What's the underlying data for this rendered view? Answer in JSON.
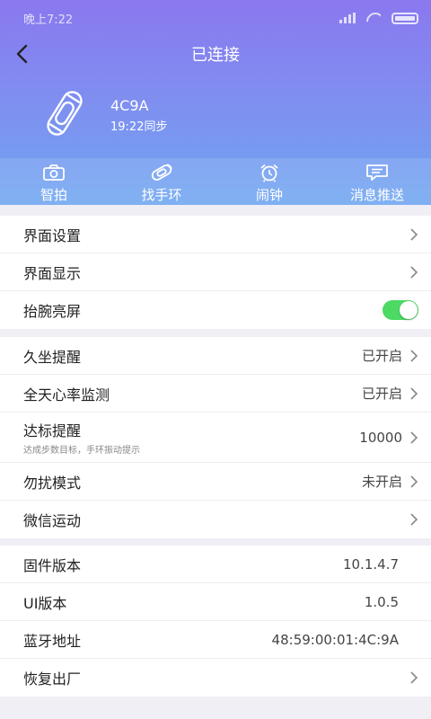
{
  "status_bar": {
    "time": "晚上7:22"
  },
  "header": {
    "title": "已连接"
  },
  "device": {
    "name": "4C9A",
    "sync_time": "19:22同步"
  },
  "toolbar": [
    {
      "label": "智拍",
      "icon": "camera-icon"
    },
    {
      "label": "找手环",
      "icon": "find-band-icon"
    },
    {
      "label": "闹钟",
      "icon": "alarm-clock-icon"
    },
    {
      "label": "消息推送",
      "icon": "message-icon"
    }
  ],
  "group1": [
    {
      "label": "界面设置"
    },
    {
      "label": "界面显示"
    },
    {
      "label": "抬腕亮屏",
      "toggle": true
    }
  ],
  "group2": [
    {
      "label": "久坐提醒",
      "value": "已开启"
    },
    {
      "label": "全天心率监测",
      "value": "已开启"
    },
    {
      "label": "达标提醒",
      "sublabel": "达成步数目标，手环振动提示",
      "value": "10000"
    },
    {
      "label": "勿扰模式",
      "value": "未开启"
    },
    {
      "label": "微信运动"
    }
  ],
  "group3": [
    {
      "label": "固件版本",
      "value": "10.1.4.7"
    },
    {
      "label": "UI版本",
      "value": "1.0.5"
    },
    {
      "label": "蓝牙地址",
      "value": "48:59:00:01:4C:9A"
    },
    {
      "label": "恢复出厂"
    }
  ],
  "colors": {
    "header_top": "#8a78ef",
    "header_bottom": "#6fa6f1",
    "toggle_on": "#4cd964"
  }
}
